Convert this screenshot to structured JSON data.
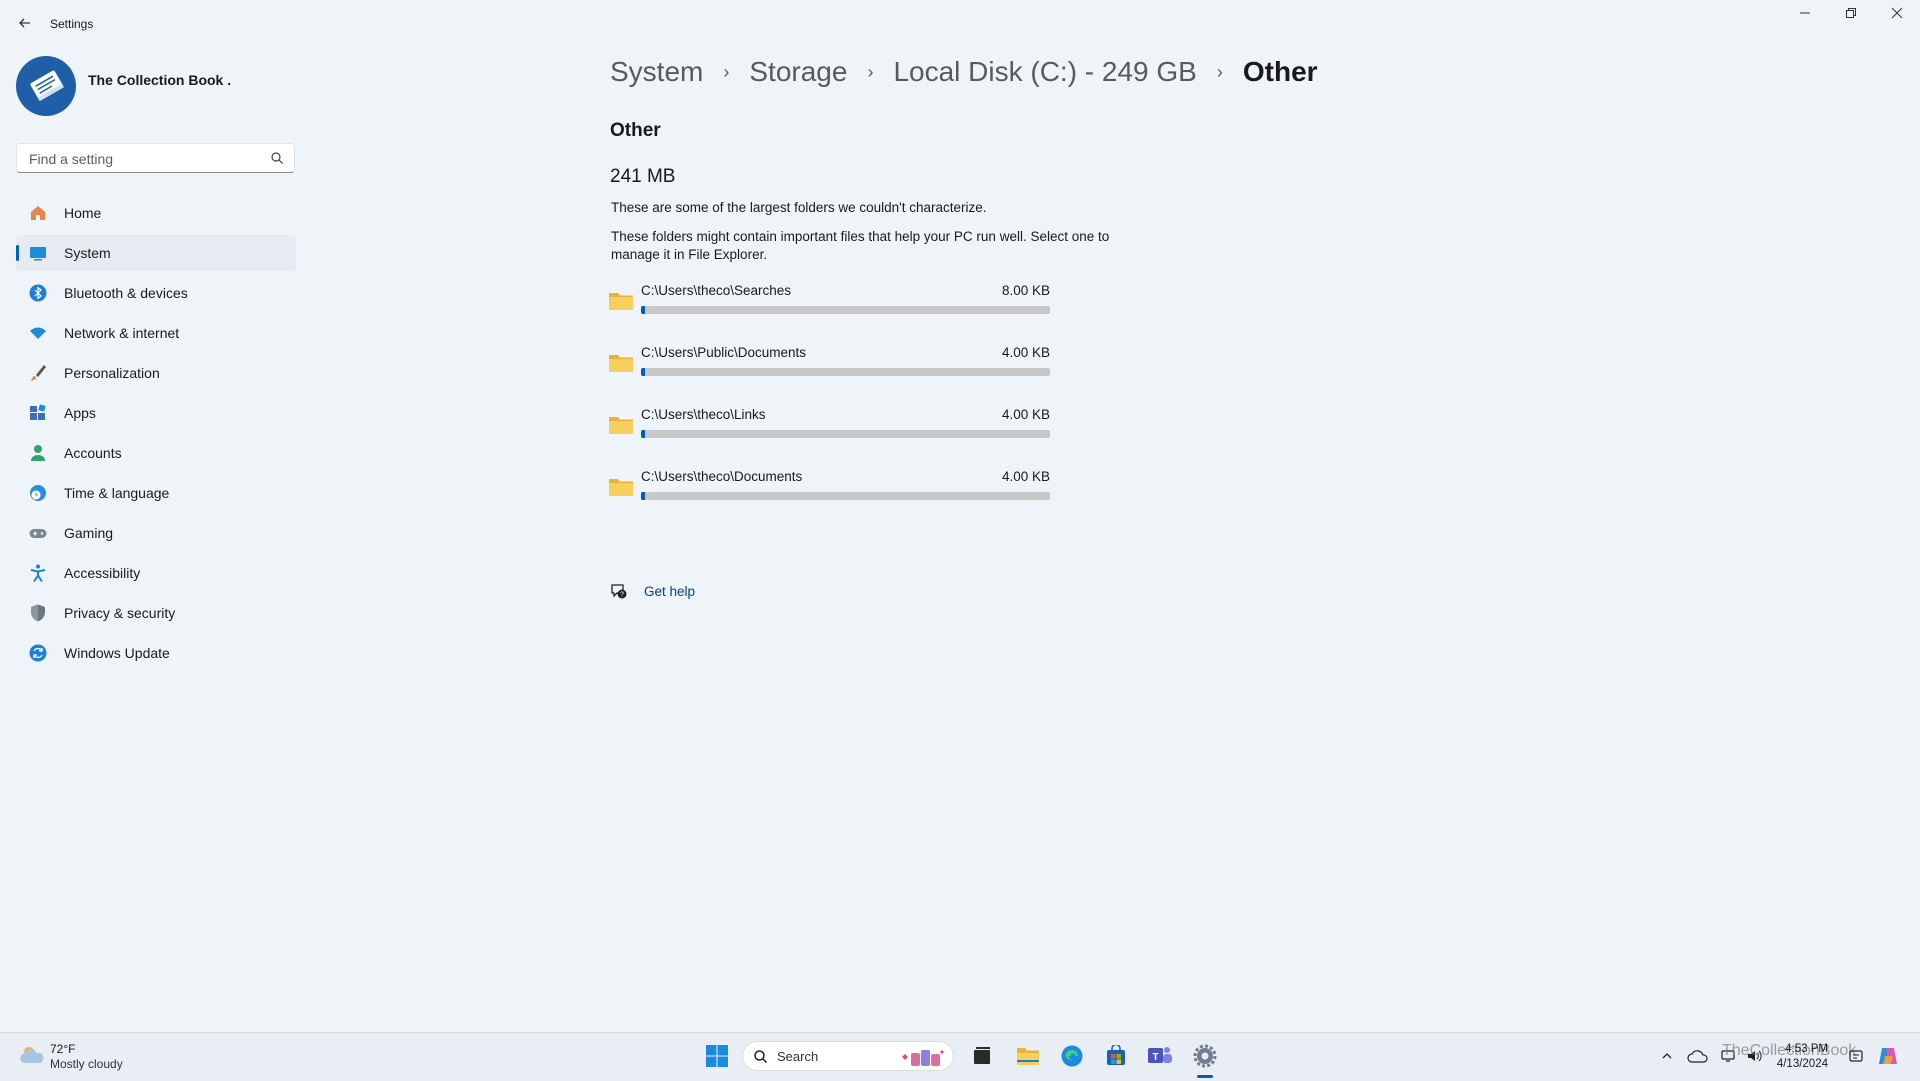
{
  "window": {
    "title": "Settings"
  },
  "profile": {
    "name": "The Collection Book ."
  },
  "search": {
    "placeholder": "Find a setting"
  },
  "sidebar": {
    "items": [
      {
        "label": "Home",
        "icon": "home-icon"
      },
      {
        "label": "System",
        "icon": "system-icon",
        "active": true
      },
      {
        "label": "Bluetooth & devices",
        "icon": "bluetooth-icon"
      },
      {
        "label": "Network & internet",
        "icon": "wifi-icon"
      },
      {
        "label": "Personalization",
        "icon": "brush-icon"
      },
      {
        "label": "Apps",
        "icon": "apps-icon"
      },
      {
        "label": "Accounts",
        "icon": "person-icon"
      },
      {
        "label": "Time & language",
        "icon": "globe-clock-icon"
      },
      {
        "label": "Gaming",
        "icon": "gamepad-icon"
      },
      {
        "label": "Accessibility",
        "icon": "accessibility-icon"
      },
      {
        "label": "Privacy & security",
        "icon": "shield-icon"
      },
      {
        "label": "Windows Update",
        "icon": "update-icon"
      }
    ]
  },
  "breadcrumb": {
    "items": [
      "System",
      "Storage",
      "Local Disk (C:) - 249 GB",
      "Other"
    ],
    "separator": "›"
  },
  "main": {
    "section_title": "Other",
    "total_size": "241 MB",
    "description_1": "These are some of the largest folders we couldn't characterize.",
    "description_2": "These folders might contain important files that help your PC run well. Select one to manage it in File Explorer.",
    "folders": [
      {
        "path": "C:\\Users\\theco\\Searches",
        "size": "8.00 KB",
        "fill": 0.01
      },
      {
        "path": "C:\\Users\\Public\\Documents",
        "size": "4.00 KB",
        "fill": 0.01
      },
      {
        "path": "C:\\Users\\theco\\Links",
        "size": "4.00 KB",
        "fill": 0.01
      },
      {
        "path": "C:\\Users\\theco\\Documents",
        "size": "4.00 KB",
        "fill": 0.01
      }
    ],
    "help_label": "Get help"
  },
  "taskbar": {
    "weather_temp": "72°F",
    "weather_desc": "Mostly cloudy",
    "search_label": "Search",
    "time": "4:53 PM",
    "date": "4/13/2024",
    "watermark": "TheCollectionBook"
  },
  "colors": {
    "accent": "#005fb8",
    "background": "#eff4f9",
    "folder": "#f4c542"
  }
}
